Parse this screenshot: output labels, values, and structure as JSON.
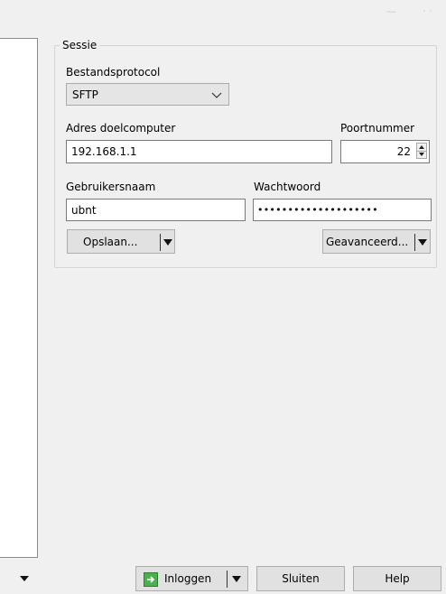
{
  "session": {
    "group_title": "Sessie",
    "protocol_label": "Bestandsprotocol",
    "protocol_value": "SFTP",
    "host_label": "Adres doelcomputer",
    "host_value": "192.168.1.1",
    "port_label": "Poortnummer",
    "port_value": "22",
    "user_label": "Gebruikersnaam",
    "user_value": "ubnt",
    "password_label": "Wachtwoord",
    "password_value": "••••••••••••••••••••",
    "save_label": "Opslaan...",
    "advanced_label": "Geavanceerd..."
  },
  "footer": {
    "login_label": "Inloggen",
    "close_label": "Sluiten",
    "help_label": "Help"
  },
  "icons": {
    "combo_arrow": "chevron-down-icon",
    "dropdown": "caret-down-icon",
    "login": "login-icon",
    "spinner_up": "spin-up-icon",
    "spinner_down": "spin-down-icon"
  },
  "colors": {
    "window_bg": "#f0f0f0",
    "button_bg": "#e1e1e1",
    "login_icon": "#4caf50"
  }
}
